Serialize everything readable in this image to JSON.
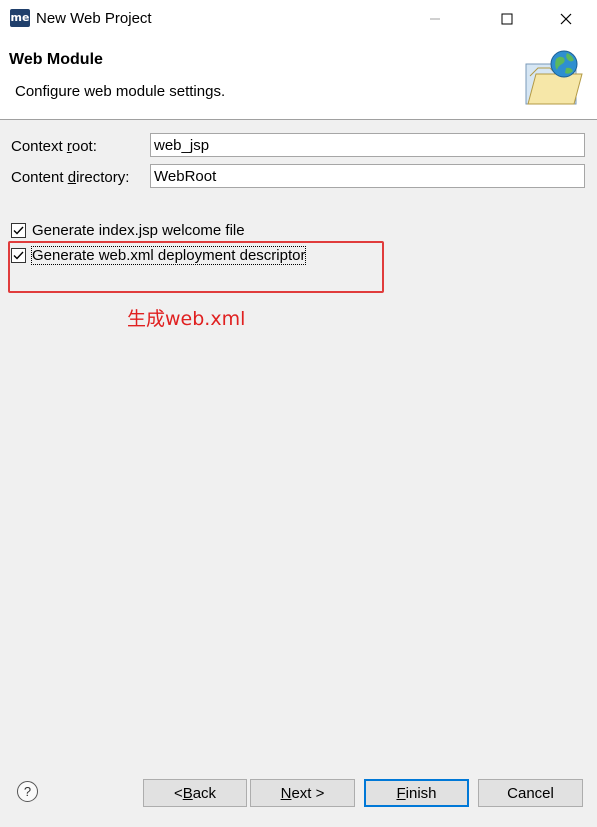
{
  "window": {
    "app_icon_text": "me",
    "title": "New Web Project",
    "minimize_icon": "minimize-icon",
    "maximize_icon": "maximize-icon",
    "close_icon": "close-icon"
  },
  "banner": {
    "title": "Web Module",
    "description": "Configure web module settings.",
    "icon": "folder-globe-icon"
  },
  "fields": {
    "context_root": {
      "label_pre": "Context ",
      "label_mnemonic": "r",
      "label_post": "oot:",
      "value": "web_jsp"
    },
    "content_directory": {
      "label_pre": "Content ",
      "label_mnemonic": "d",
      "label_post": "irectory:",
      "value": "WebRoot"
    }
  },
  "options": {
    "generate_index": {
      "label": "Generate index.jsp welcome file",
      "checked": true
    },
    "generate_webxml": {
      "label": "Generate web.xml deployment descriptor",
      "checked": true
    }
  },
  "annotation": {
    "text": "生成web.xml",
    "color": "#e02020"
  },
  "buttons": {
    "help_icon": "help-icon",
    "back": {
      "pre": "< ",
      "mnemonic": "B",
      "post": "ack"
    },
    "next": {
      "mnemonic": "N",
      "post": "ext >"
    },
    "finish": {
      "mnemonic": "F",
      "post": "inish"
    },
    "cancel": "Cancel"
  },
  "colors": {
    "accent": "#0078d7",
    "highlight": "#e03c3c"
  }
}
